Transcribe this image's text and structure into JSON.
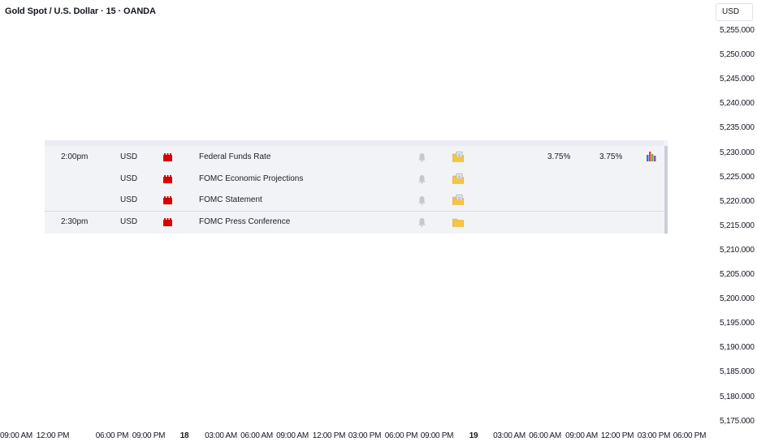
{
  "chart": {
    "title": "Gold Spot / U.S. Dollar · 15 · OANDA",
    "currency": "USD"
  },
  "price_axis": {
    "labels": [
      "5,255.000",
      "5,250.000",
      "5,245.000",
      "5,240.000",
      "5,235.000",
      "5,230.000",
      "5,225.000",
      "5,220.000",
      "5,215.000",
      "5,210.000",
      "5,205.000",
      "5,200.000",
      "5,195.000",
      "5,190.000",
      "5,185.000",
      "5,180.000",
      "5,175.000"
    ]
  },
  "time_axis": {
    "labels": [
      {
        "text": "09:00 AM",
        "bold": false
      },
      {
        "text": "12:00 PM",
        "bold": false
      },
      {
        "text": "06:00 PM",
        "bold": false
      },
      {
        "text": "09:00 PM",
        "bold": false
      },
      {
        "text": "18",
        "bold": true
      },
      {
        "text": "03:00 AM",
        "bold": false
      },
      {
        "text": "06:00 AM",
        "bold": false
      },
      {
        "text": "09:00 AM",
        "bold": false
      },
      {
        "text": "12:00 PM",
        "bold": false
      },
      {
        "text": "03:00 PM",
        "bold": false
      },
      {
        "text": "06:00 PM",
        "bold": false
      },
      {
        "text": "09:00 PM",
        "bold": false
      },
      {
        "text": "19",
        "bold": true
      },
      {
        "text": "03:00 AM",
        "bold": false
      },
      {
        "text": "06:00 AM",
        "bold": false
      },
      {
        "text": "09:00 AM",
        "bold": false
      },
      {
        "text": "12:00 PM",
        "bold": false
      },
      {
        "text": "03:00 PM",
        "bold": false
      },
      {
        "text": "06:00 PM",
        "bold": false
      }
    ]
  },
  "calendar": {
    "colors": {
      "flag": "#d90000",
      "bell": "#c4c7cc",
      "folder": "#f5c542",
      "folder_edge": "#d9a520"
    },
    "rows": [
      {
        "time": "2:00pm",
        "currency": "USD",
        "event": "Federal Funds Rate",
        "folder_icon": "folder-page-icon",
        "actual": "3.75%",
        "forecast": "3.75%",
        "chart_icon": true
      },
      {
        "time": "",
        "currency": "USD",
        "event": "FOMC Economic Projections",
        "folder_icon": "folder-page-icon",
        "actual": "",
        "forecast": "",
        "chart_icon": false
      },
      {
        "time": "",
        "currency": "USD",
        "event": "FOMC Statement",
        "folder_icon": "folder-page-icon",
        "actual": "",
        "forecast": "",
        "chart_icon": false
      },
      {
        "time": "2:30pm",
        "currency": "USD",
        "event": "FOMC Press Conference",
        "folder_icon": "folder-icon",
        "actual": "",
        "forecast": "",
        "chart_icon": false
      }
    ]
  }
}
